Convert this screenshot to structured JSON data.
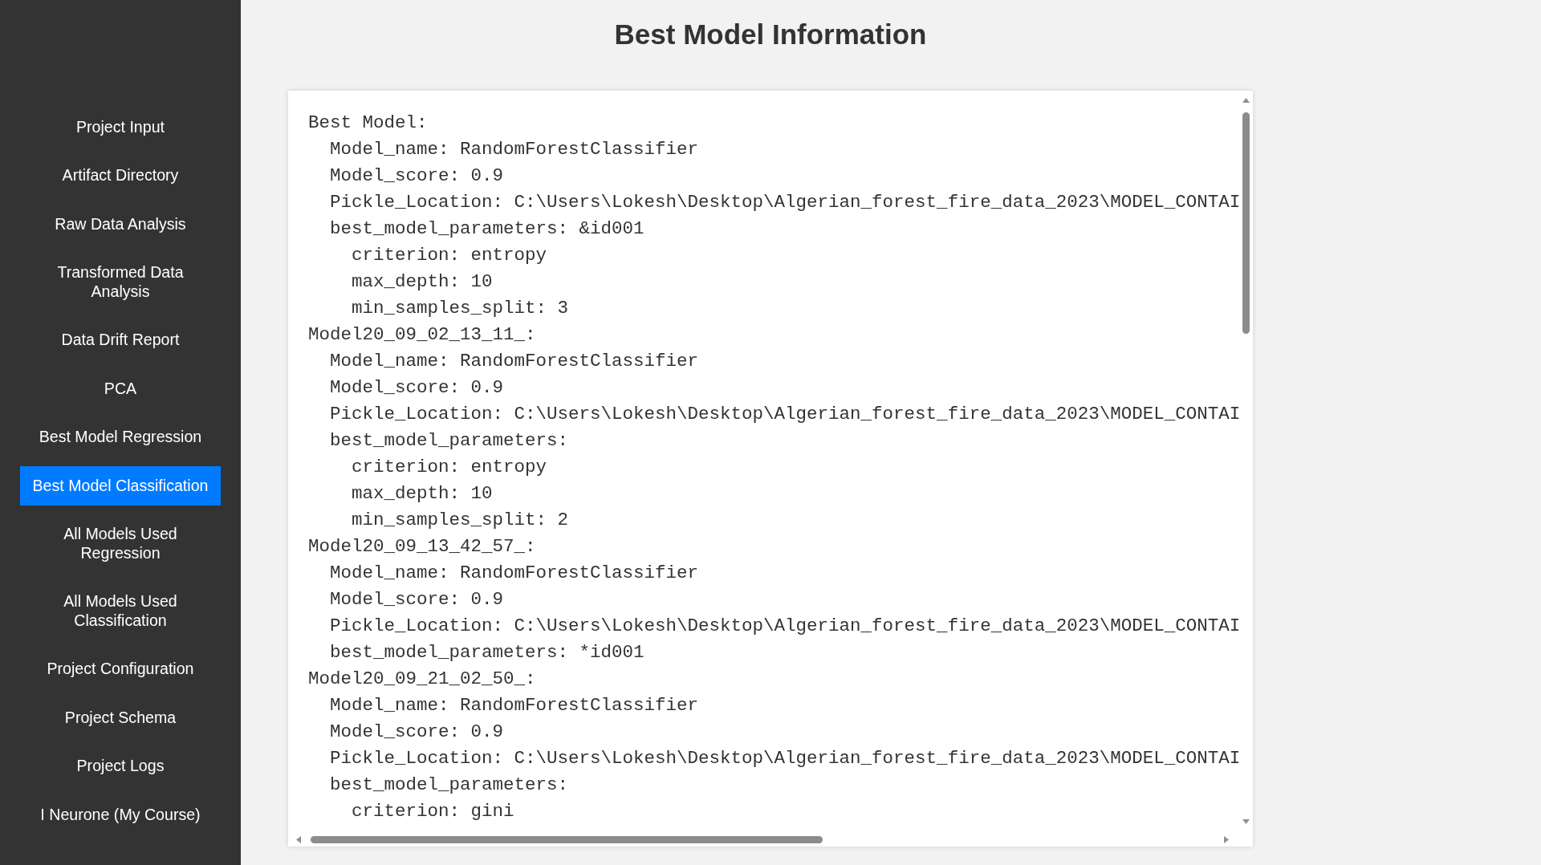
{
  "sidebar": {
    "items": [
      {
        "label": "Project Input",
        "selected": false
      },
      {
        "label": "Artifact Directory",
        "selected": false
      },
      {
        "label": "Raw Data Analysis",
        "selected": false
      },
      {
        "label": "Transformed Data Analysis",
        "selected": false
      },
      {
        "label": "Data Drift Report",
        "selected": false
      },
      {
        "label": "PCA",
        "selected": false
      },
      {
        "label": "Best Model Regression",
        "selected": false
      },
      {
        "label": "Best Model Classification",
        "selected": true
      },
      {
        "label": "All Models Used Regression",
        "selected": false
      },
      {
        "label": "All Models Used Classification",
        "selected": false
      },
      {
        "label": "Project Configuration",
        "selected": false
      },
      {
        "label": "Project Schema",
        "selected": false
      },
      {
        "label": "Project Logs",
        "selected": false
      },
      {
        "label": "I Neurone (My Course)",
        "selected": false
      }
    ]
  },
  "main": {
    "title": "Best Model Information",
    "code_view": {
      "entries": [
        {
          "text": "Best Model:",
          "children": [
            {
              "text": "Model_name: RandomForestClassifier"
            },
            {
              "text": "Model_score: 0.9"
            },
            {
              "text": "Pickle_Location: C:\\Users\\Lokesh\\Desktop\\Algerian_forest_fire_data_2023\\MODEL_CONTAI"
            },
            {
              "text": "best_model_parameters: &id001",
              "children": [
                {
                  "text": "criterion: entropy"
                },
                {
                  "text": "max_depth: 10"
                },
                {
                  "text": "min_samples_split: 3"
                }
              ]
            }
          ]
        },
        {
          "text": "Model20_09_02_13_11_:",
          "children": [
            {
              "text": "Model_name: RandomForestClassifier"
            },
            {
              "text": "Model_score: 0.9"
            },
            {
              "text": "Pickle_Location: C:\\Users\\Lokesh\\Desktop\\Algerian_forest_fire_data_2023\\MODEL_CONTAI"
            },
            {
              "text": "best_model_parameters:",
              "children": [
                {
                  "text": "criterion: entropy"
                },
                {
                  "text": "max_depth: 10"
                },
                {
                  "text": "min_samples_split: 2"
                }
              ]
            }
          ]
        },
        {
          "text": "Model20_09_13_42_57_:",
          "children": [
            {
              "text": "Model_name: RandomForestClassifier"
            },
            {
              "text": "Model_score: 0.9"
            },
            {
              "text": "Pickle_Location: C:\\Users\\Lokesh\\Desktop\\Algerian_forest_fire_data_2023\\MODEL_CONTAI"
            },
            {
              "text": "best_model_parameters: *id001"
            }
          ]
        },
        {
          "text": "Model20_09_21_02_50_:",
          "children": [
            {
              "text": "Model_name: RandomForestClassifier"
            },
            {
              "text": "Model_score: 0.9"
            },
            {
              "text": "Pickle_Location: C:\\Users\\Lokesh\\Desktop\\Algerian_forest_fire_data_2023\\MODEL_CONTAI"
            },
            {
              "text": "best_model_parameters:",
              "children": [
                {
                  "text": "criterion: gini"
                }
              ]
            }
          ]
        }
      ]
    }
  }
}
